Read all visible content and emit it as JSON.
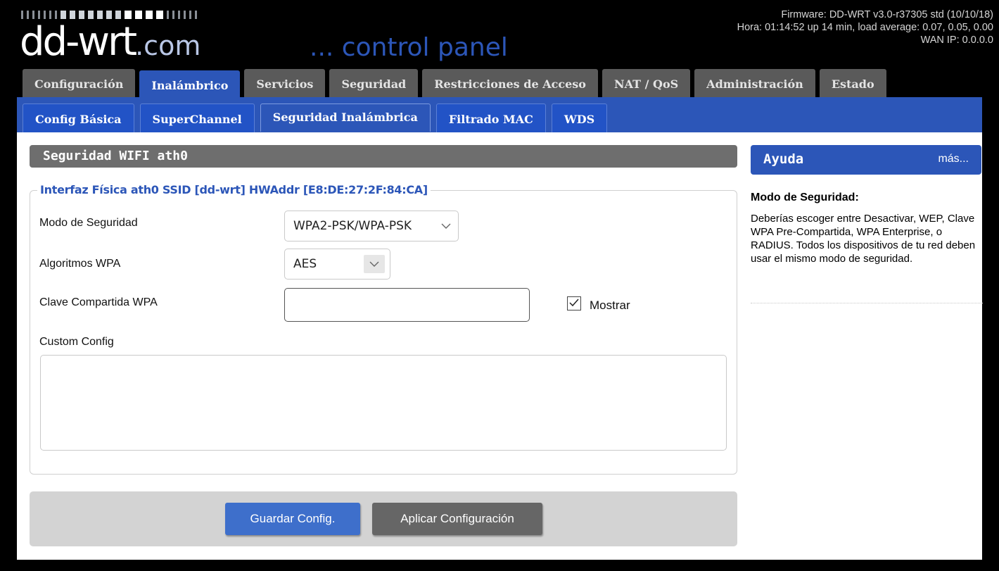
{
  "header": {
    "logo_text": "dd-wrt",
    "logo_suffix": ".com",
    "subtitle": "... control panel",
    "firmware": "Firmware: DD-WRT v3.0-r37305 std (10/10/18)",
    "uptime": "Hora: 01:14:52 up 14 min, load average: 0.07, 0.05, 0.00",
    "wan_ip": "WAN IP: 0.0.0.0"
  },
  "main_tabs": [
    {
      "label": "Configuración"
    },
    {
      "label": "Inalámbrico"
    },
    {
      "label": "Servicios"
    },
    {
      "label": "Seguridad"
    },
    {
      "label": "Restricciones de Acceso"
    },
    {
      "label": "NAT / QoS"
    },
    {
      "label": "Administración"
    },
    {
      "label": "Estado"
    }
  ],
  "sub_tabs": [
    {
      "label": "Config Básica"
    },
    {
      "label": "SuperChannel"
    },
    {
      "label": "Seguridad Inalámbrica"
    },
    {
      "label": "Filtrado MAC"
    },
    {
      "label": "WDS"
    }
  ],
  "section": {
    "title": "Seguridad WIFI ath0",
    "legend": "Interfaz Física ath0 SSID [dd-wrt] HWAddr [E8:DE:27:2F:84:CA]",
    "security_mode_label": "Modo de Seguridad",
    "security_mode_value": "WPA2-PSK/WPA-PSK",
    "wpa_algorithms_label": "Algoritmos WPA",
    "wpa_algorithms_value": "AES",
    "shared_key_label": "Clave Compartida WPA",
    "shared_key_value": "",
    "show_label": "Mostrar",
    "show_checked": true,
    "custom_config_label": "Custom Config",
    "custom_config_value": ""
  },
  "buttons": {
    "save": "Guardar Config.",
    "apply": "Aplicar Configuración"
  },
  "help": {
    "title": "Ayuda",
    "more": "más...",
    "heading": "Modo de Seguridad:",
    "text": "Deberías escoger entre Desactivar, WEP, Clave WPA Pre-Compartida, WPA Enterprise, o RADIUS. Todos los dispositivos de tu red deben usar el mismo modo de seguridad."
  },
  "colors": {
    "accent": "#2c56b8",
    "tab_inactive": "#5a5a5a",
    "section_bar": "#6e6e6e",
    "save_button": "#3e6fcb",
    "apply_button": "#666666"
  },
  "icons": {
    "dropdown": "chevron-down-icon",
    "checkbox": "checkmark-icon"
  }
}
